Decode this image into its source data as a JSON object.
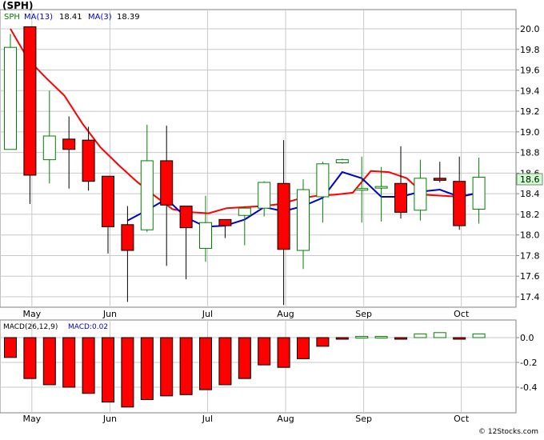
{
  "header": {
    "title": "(SPH)",
    "legend_symbol": "SPH",
    "legend_ma13": "MA(13)",
    "legend_ma13_value": "18.41",
    "legend_ma3": "MA(3)",
    "legend_ma3_value": "18.39",
    "macd_label": "MACD(26,12,9)",
    "macd_value_label": "MACD:0.02",
    "watermark": "© 12Stocks.com"
  },
  "colors": {
    "up": "#008000",
    "down": "#ff0000",
    "ma13": "#ff0000",
    "ma3": "#0000cc",
    "legend_symbol": "#008000",
    "legend_ma13": "#0000cc",
    "legend_ma3": "#0000cc",
    "macd_label": "#000000",
    "macd_value": "#0000cc",
    "grid": "#c8c8c8",
    "last_price_bg": "#ccffcc"
  },
  "chart_data": [
    {
      "type": "candlestick",
      "period": "weekly",
      "ylim": [
        17.3,
        20.2
      ],
      "yticks": [
        17.4,
        17.6,
        17.8,
        18.0,
        18.2,
        18.4,
        18.6,
        18.8,
        19.0,
        19.2,
        19.4,
        19.6,
        19.8,
        20.0
      ],
      "x_tick_labels": [
        "May",
        "Jun",
        "Jul",
        "Aug",
        "Sep",
        "Oct"
      ],
      "x_tick_index": [
        1.1,
        5.1,
        10.1,
        14.1,
        18.1,
        23.1
      ],
      "last_price_label": "18.6",
      "last_price": 18.6,
      "grid": true,
      "candles": [
        {
          "open": 18.83,
          "high": 19.95,
          "low": 19.25,
          "close": 19.82
        },
        {
          "open": 20.02,
          "high": 20.02,
          "low": 18.3,
          "close": 18.58
        },
        {
          "open": 18.73,
          "high": 19.4,
          "low": 18.5,
          "close": 18.96
        },
        {
          "open": 18.93,
          "high": 19.15,
          "low": 18.45,
          "close": 18.83
        },
        {
          "open": 18.92,
          "high": 19.05,
          "low": 18.43,
          "close": 18.52
        },
        {
          "open": 18.57,
          "high": 18.57,
          "low": 17.82,
          "close": 18.08
        },
        {
          "open": 18.1,
          "high": 18.28,
          "low": 17.35,
          "close": 17.85
        },
        {
          "open": 18.05,
          "high": 19.07,
          "low": 18.03,
          "close": 18.72
        },
        {
          "open": 18.72,
          "high": 19.06,
          "low": 17.7,
          "close": 18.29
        },
        {
          "open": 18.28,
          "high": 18.28,
          "low": 17.57,
          "close": 18.07
        },
        {
          "open": 17.87,
          "high": 18.38,
          "low": 17.74,
          "close": 18.12
        },
        {
          "open": 18.15,
          "high": 18.15,
          "low": 17.97,
          "close": 18.09
        },
        {
          "open": 18.19,
          "high": 18.28,
          "low": 17.9,
          "close": 18.26
        },
        {
          "open": 18.26,
          "high": 18.52,
          "low": 18.18,
          "close": 18.51
        },
        {
          "open": 18.5,
          "high": 18.92,
          "low": 17.32,
          "close": 17.86
        },
        {
          "open": 17.85,
          "high": 18.54,
          "low": 17.67,
          "close": 18.44
        },
        {
          "open": 18.37,
          "high": 18.71,
          "low": 18.12,
          "close": 18.69
        },
        {
          "open": 18.7,
          "high": 18.74,
          "low": 18.69,
          "close": 18.73
        },
        {
          "open": 18.44,
          "high": 18.76,
          "low": 18.12,
          "close": 18.45
        },
        {
          "open": 18.46,
          "high": 18.66,
          "low": 18.13,
          "close": 18.47
        },
        {
          "open": 18.5,
          "high": 18.86,
          "low": 18.16,
          "close": 18.22
        },
        {
          "open": 18.24,
          "high": 18.73,
          "low": 18.14,
          "close": 18.55
        },
        {
          "open": 18.55,
          "high": 18.71,
          "low": 18.51,
          "close": 18.53
        },
        {
          "open": 18.52,
          "high": 18.76,
          "low": 18.05,
          "close": 18.09
        },
        {
          "open": 18.25,
          "high": 18.75,
          "low": 18.11,
          "close": 18.56
        }
      ],
      "ma13": [
        null,
        20.0,
        19.7,
        19.58,
        19.43,
        19.33,
        19.14,
        18.9,
        18.8,
        18.62,
        18.39,
        18.34,
        18.26,
        18.25,
        18.62,
        18.61,
        18.55,
        18.37,
        18.43,
        18.38,
        18.41
      ],
      "ma13_start_index": 0,
      "ma13_full": [
        20.0,
        19.85,
        19.72,
        19.58,
        19.43,
        19.33,
        19.14,
        18.9,
        18.8,
        18.62,
        18.39,
        18.34,
        18.26,
        18.25,
        18.62,
        18.61,
        18.55,
        18.37,
        18.43,
        18.38,
        18.41
      ],
      "ma13_indices": [
        0,
        1,
        2,
        3,
        4,
        5,
        6,
        8,
        10,
        11,
        12,
        13,
        14,
        15,
        17,
        18,
        19,
        20,
        21,
        22,
        24
      ],
      "ma13_series": [
        20.0,
        19.7,
        19.52,
        19.35,
        19.08,
        18.85,
        18.68,
        18.52,
        18.38,
        18.25,
        18.22,
        18.21,
        18.26,
        18.27,
        18.28,
        18.3,
        18.35,
        18.38,
        18.39,
        18.41,
        18.62,
        18.61,
        18.55,
        18.39,
        18.38,
        18.37,
        18.41
      ],
      "ma3_series": [
        null,
        null,
        null,
        null,
        null,
        null,
        18.14,
        18.24,
        18.35,
        18.17,
        18.08,
        18.09,
        18.15,
        18.27,
        18.23,
        18.28,
        18.36,
        18.61,
        18.55,
        18.37,
        18.37,
        18.42,
        18.44,
        18.37,
        18.41
      ]
    },
    {
      "type": "bar",
      "title": "MACD(26,12,9)",
      "ylim": [
        -0.58,
        0.12
      ],
      "yticks": [
        0.0,
        -0.2,
        -0.4
      ],
      "values": [
        -0.16,
        -0.33,
        -0.38,
        -0.4,
        -0.45,
        -0.52,
        -0.56,
        -0.5,
        -0.47,
        -0.46,
        -0.42,
        -0.38,
        -0.33,
        -0.22,
        -0.24,
        -0.17,
        -0.07,
        -0.01,
        0.01,
        0.01,
        -0.01,
        0.03,
        0.04,
        -0.01,
        0.03
      ]
    }
  ]
}
